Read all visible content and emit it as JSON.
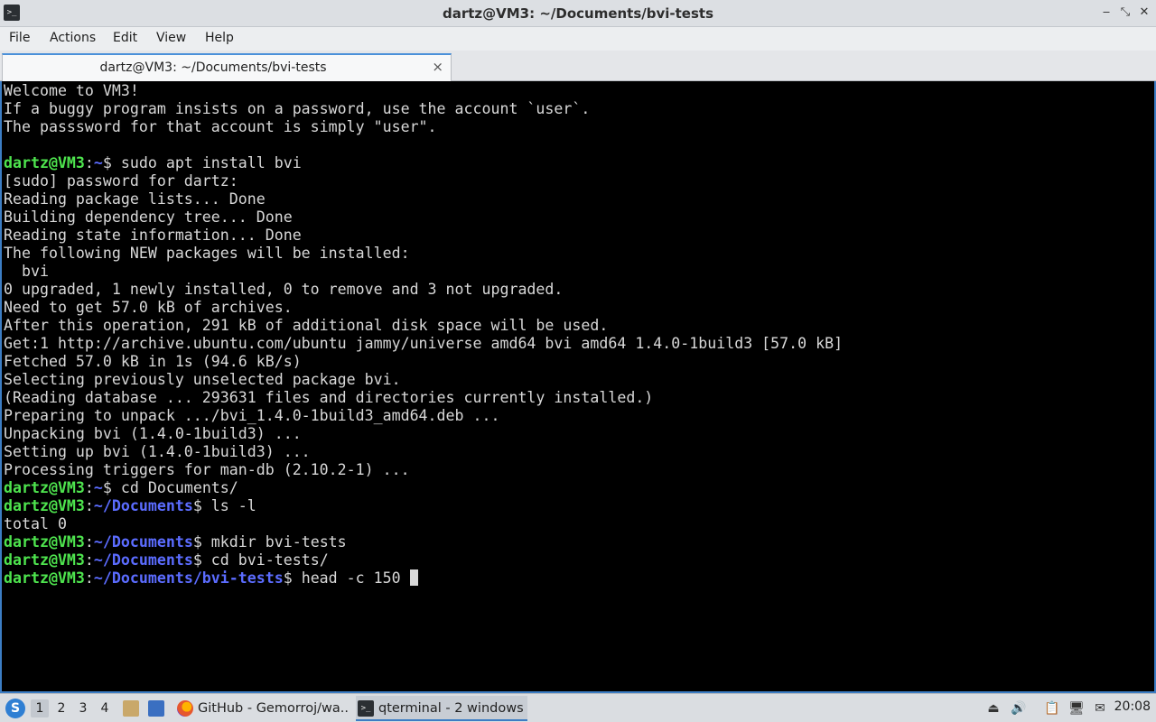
{
  "window": {
    "title": "dartz@VM3: ~/Documents/bvi-tests",
    "app_icon": "terminal-icon",
    "controls": [
      "minimize-icon",
      "maximize-icon",
      "close-icon"
    ]
  },
  "menu": {
    "file": "File",
    "actions": "Actions",
    "edit": "Edit",
    "view": "View",
    "help": "Help"
  },
  "tabs": [
    {
      "label": "dartz@VM3: ~/Documents/bvi-tests",
      "close": "×"
    }
  ],
  "terminal": {
    "colors": {
      "background": "#000000",
      "text": "#d8d8d8",
      "user": "#4ee44e",
      "path": "#5b6cff"
    },
    "lines": [
      {
        "text": "Welcome to VM3!"
      },
      {
        "text": "If a buggy program insists on a password, use the account `user`."
      },
      {
        "text": "The passsword for that account is simply \"user\"."
      },
      {
        "text": ""
      },
      {
        "user": "dartz@VM3",
        "path": "~",
        "cmd": "$ sudo apt install bvi"
      },
      {
        "text": "[sudo] password for dartz:"
      },
      {
        "text": "Reading package lists... Done"
      },
      {
        "text": "Building dependency tree... Done"
      },
      {
        "text": "Reading state information... Done"
      },
      {
        "text": "The following NEW packages will be installed:"
      },
      {
        "text": "  bvi"
      },
      {
        "text": "0 upgraded, 1 newly installed, 0 to remove and 3 not upgraded."
      },
      {
        "text": "Need to get 57.0 kB of archives."
      },
      {
        "text": "After this operation, 291 kB of additional disk space will be used."
      },
      {
        "text": "Get:1 http://archive.ubuntu.com/ubuntu jammy/universe amd64 bvi amd64 1.4.0-1build3 [57.0 kB]"
      },
      {
        "text": "Fetched 57.0 kB in 1s (94.6 kB/s)"
      },
      {
        "text": "Selecting previously unselected package bvi."
      },
      {
        "text": "(Reading database ... 293631 files and directories currently installed.)"
      },
      {
        "text": "Preparing to unpack .../bvi_1.4.0-1build3_amd64.deb ..."
      },
      {
        "text": "Unpacking bvi (1.4.0-1build3) ..."
      },
      {
        "text": "Setting up bvi (1.4.0-1build3) ..."
      },
      {
        "text": "Processing triggers for man-db (2.10.2-1) ..."
      },
      {
        "user": "dartz@VM3",
        "path": "~",
        "cmd": "$ cd Documents/"
      },
      {
        "user": "dartz@VM3",
        "path": "~/Documents",
        "cmd": "$ ls -l"
      },
      {
        "text": "total 0"
      },
      {
        "user": "dartz@VM3",
        "path": "~/Documents",
        "cmd": "$ mkdir bvi-tests"
      },
      {
        "user": "dartz@VM3",
        "path": "~/Documents",
        "cmd": "$ cd bvi-tests/"
      },
      {
        "user": "dartz@VM3",
        "path": "~/Documents/bvi-tests",
        "cmd": "$ head -c 150 ",
        "cursor": true
      }
    ]
  },
  "taskbar": {
    "start_icon": "lxqt-menu-icon",
    "workspaces": [
      "1",
      "2",
      "3",
      "4"
    ],
    "active_workspace": "1",
    "quicklaunch": [
      "file-manager-icon",
      "show-desktop-icon"
    ],
    "tasks": [
      {
        "icon": "firefox-icon",
        "label": "GitHub - Gemorroj/wa..."
      },
      {
        "icon": "terminal-icon",
        "label": "qterminal - 2 windows"
      }
    ],
    "tray": [
      "storage-icon",
      "volume-icon",
      "clipboard-icon",
      "network-icon",
      "update-notifier-icon"
    ],
    "clock": "20:08"
  }
}
